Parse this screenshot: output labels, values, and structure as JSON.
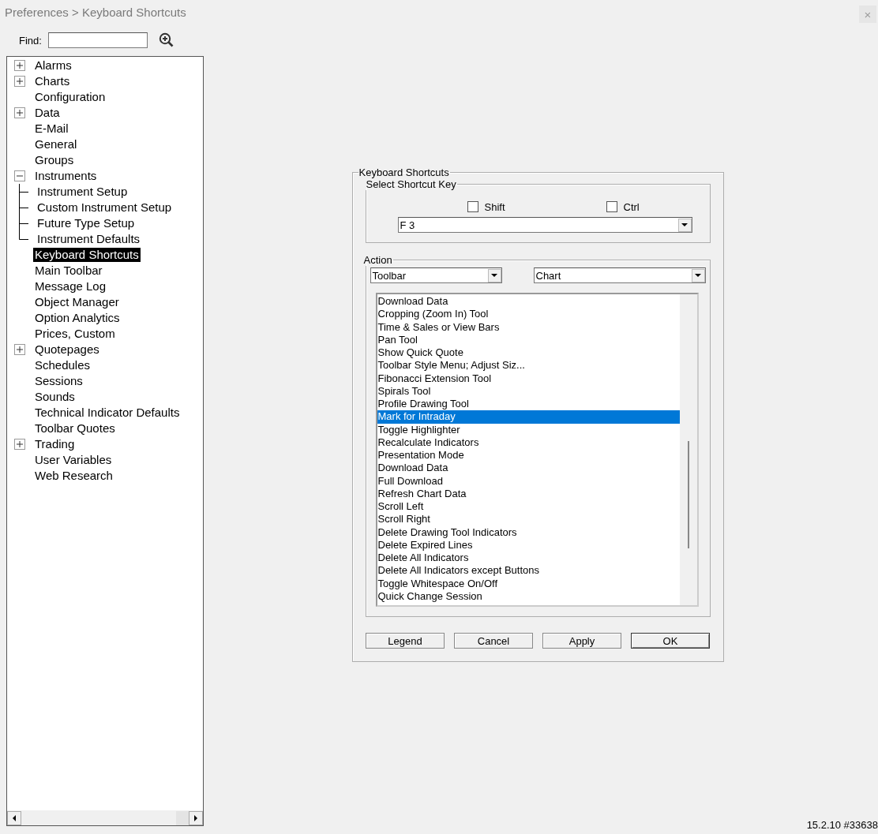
{
  "window": {
    "title": "Preferences > Keyboard Shortcuts",
    "close": "×"
  },
  "find": {
    "label": "Find:"
  },
  "tree": {
    "items": [
      {
        "label": "Alarms",
        "expanded": false,
        "selected": false
      },
      {
        "label": "Charts",
        "expanded": false,
        "selected": false
      },
      {
        "label": "Configuration",
        "selected": false
      },
      {
        "label": "Data",
        "expanded": false,
        "selected": false
      },
      {
        "label": "E-Mail",
        "selected": false
      },
      {
        "label": "General",
        "selected": false
      },
      {
        "label": "Groups",
        "selected": false
      },
      {
        "label": "Instruments",
        "expanded": true,
        "selected": false,
        "children": [
          {
            "label": "Instrument Setup",
            "selected": false
          },
          {
            "label": "Custom Instrument Setup",
            "selected": false
          },
          {
            "label": "Future Type Setup",
            "selected": false
          },
          {
            "label": "Instrument Defaults",
            "selected": false
          }
        ]
      },
      {
        "label": "Keyboard Shortcuts",
        "selected": true
      },
      {
        "label": "Main Toolbar",
        "selected": false
      },
      {
        "label": "Message Log",
        "selected": false
      },
      {
        "label": "Object Manager",
        "selected": false
      },
      {
        "label": "Option Analytics",
        "selected": false
      },
      {
        "label": "Prices, Custom",
        "selected": false
      },
      {
        "label": "Quotepages",
        "expanded": false,
        "selected": false
      },
      {
        "label": "Schedules",
        "selected": false
      },
      {
        "label": "Sessions",
        "selected": false
      },
      {
        "label": "Sounds",
        "selected": false
      },
      {
        "label": "Technical Indicator Defaults",
        "selected": false
      },
      {
        "label": "Toolbar Quotes",
        "selected": false
      },
      {
        "label": "Trading",
        "expanded": false,
        "selected": false
      },
      {
        "label": "User Variables",
        "selected": false
      },
      {
        "label": "Web Research",
        "selected": false
      }
    ]
  },
  "dialog": {
    "title": "Keyboard Shortcuts",
    "shortcut_key": {
      "title": "Select Shortcut Key",
      "modifiers": [
        {
          "label": "Shift",
          "checked": false
        },
        {
          "label": "Ctrl",
          "checked": false
        }
      ],
      "key": "F 3"
    },
    "action": {
      "title": "Action",
      "category": "Toolbar",
      "context": "Chart",
      "items": [
        {
          "label": "Download Data",
          "selected": false
        },
        {
          "label": "Cropping (Zoom In) Tool",
          "selected": false
        },
        {
          "label": "Time & Sales or View Bars",
          "selected": false
        },
        {
          "label": "Pan Tool",
          "selected": false
        },
        {
          "label": "Show Quick Quote",
          "selected": false
        },
        {
          "label": "Toolbar Style Menu; Adjust Siz...",
          "selected": false
        },
        {
          "label": "Fibonacci Extension Tool",
          "selected": false
        },
        {
          "label": "Spirals Tool",
          "selected": false
        },
        {
          "label": "Profile Drawing Tool",
          "selected": false
        },
        {
          "label": "Mark for Intraday",
          "selected": true
        },
        {
          "label": "Toggle Highlighter",
          "selected": false
        },
        {
          "label": "Recalculate Indicators",
          "selected": false
        },
        {
          "label": "Presentation Mode",
          "selected": false
        },
        {
          "label": "Download Data",
          "selected": false
        },
        {
          "label": "Full Download",
          "selected": false
        },
        {
          "label": "Refresh Chart Data",
          "selected": false
        },
        {
          "label": "Scroll Left",
          "selected": false
        },
        {
          "label": "Scroll Right",
          "selected": false
        },
        {
          "label": "Delete Drawing Tool Indicators",
          "selected": false
        },
        {
          "label": "Delete Expired Lines",
          "selected": false
        },
        {
          "label": "Delete All Indicators",
          "selected": false
        },
        {
          "label": "Delete All Indicators except Buttons",
          "selected": false
        },
        {
          "label": "Toggle Whitespace On/Off",
          "selected": false
        },
        {
          "label": "Quick Change Session",
          "selected": false
        }
      ]
    },
    "buttons": [
      {
        "label": "Legend",
        "default": false
      },
      {
        "label": "Cancel",
        "default": false
      },
      {
        "label": "Apply",
        "default": false
      },
      {
        "label": "OK",
        "default": true
      }
    ]
  },
  "status": {
    "version": "15.2.10 #33638"
  }
}
